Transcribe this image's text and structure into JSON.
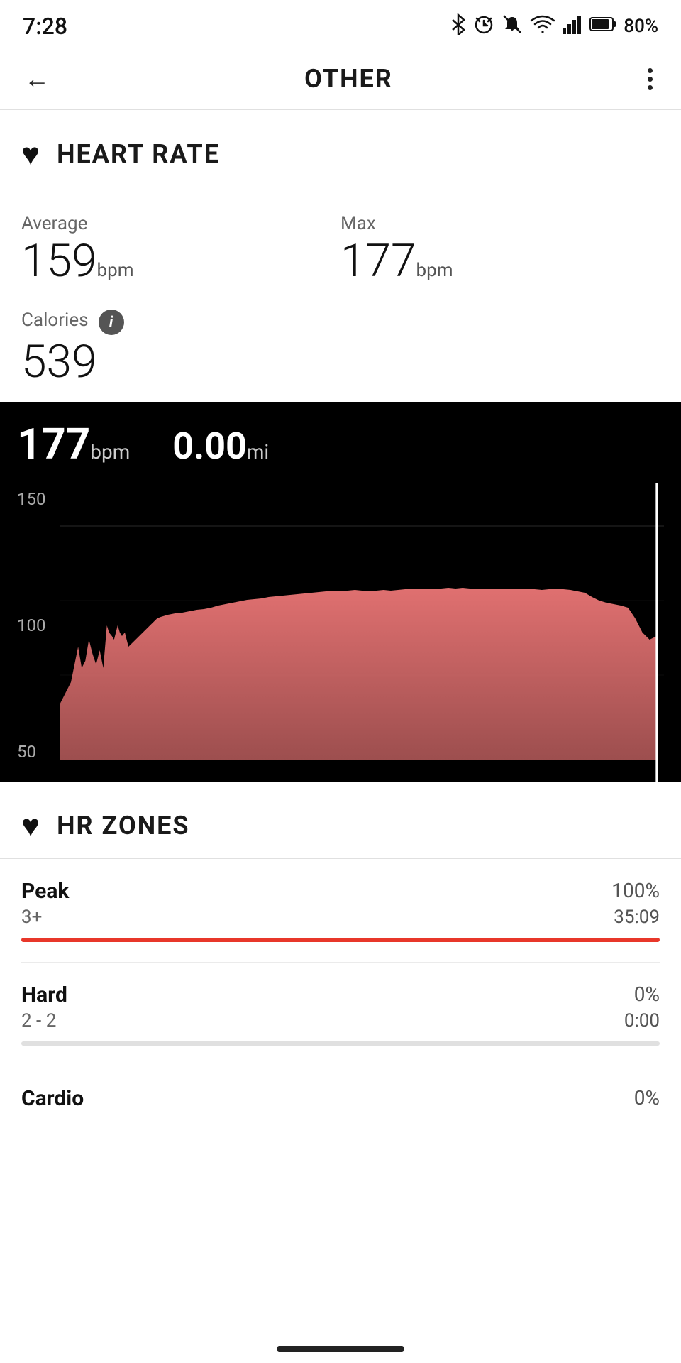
{
  "statusBar": {
    "time": "7:28",
    "batteryPct": "80%"
  },
  "nav": {
    "backLabel": "←",
    "title": "OTHER"
  },
  "heartRate": {
    "sectionTitle": "HEART RATE",
    "averageLabel": "Average",
    "averageValue": "159",
    "averageUnit": "bpm",
    "maxLabel": "Max",
    "maxValue": "177",
    "maxUnit": "bpm",
    "caloriesLabel": "Calories",
    "caloriesValue": "539",
    "chartBpm": "177",
    "chartBpmUnit": "bpm",
    "chartDist": "0.00",
    "chartDistUnit": "mi",
    "yLabels": [
      "150",
      "100",
      "50"
    ]
  },
  "hrZones": {
    "sectionTitle": "HR ZONES",
    "zones": [
      {
        "name": "Peak",
        "range": "3+",
        "pct": "100%",
        "time": "35:09",
        "barColor": "red"
      },
      {
        "name": "Hard",
        "range": "2 - 2",
        "pct": "0%",
        "time": "0:00",
        "barColor": "gray"
      },
      {
        "name": "Cardio",
        "range": "",
        "pct": "0%",
        "time": "",
        "barColor": "gray"
      }
    ]
  }
}
